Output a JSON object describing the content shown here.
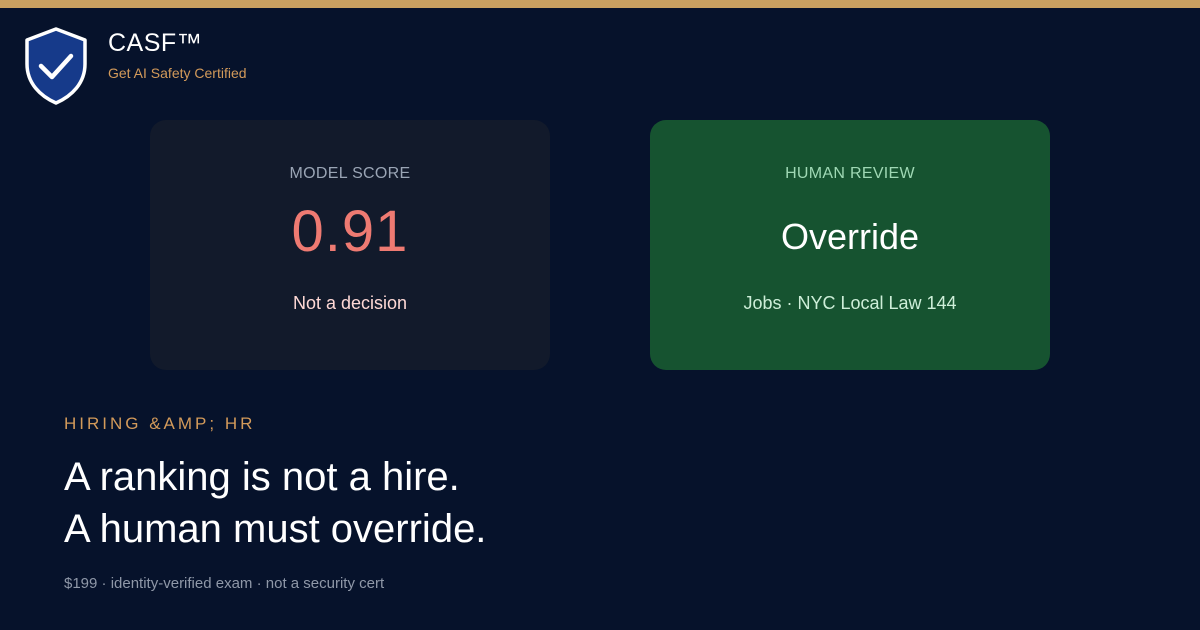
{
  "brand": {
    "name": "CASF™",
    "tagline": "Get AI Safety Certified",
    "icon": "shield-check-icon",
    "accent_color": "#c9a061"
  },
  "cards": {
    "model_score": {
      "label": "MODEL SCORE",
      "value": "0.91",
      "subtext": "Not a decision",
      "value_color": "#ee7a72"
    },
    "human_review": {
      "label": "HUMAN REVIEW",
      "value": "Override",
      "subtext": "Jobs · NYC Local Law 144",
      "background_color": "#165330"
    }
  },
  "content": {
    "eyebrow": "HIRING &AMP; HR",
    "headline_line1": "A ranking is not a hire.",
    "headline_line2": "A human must override.",
    "footnote": "$199 · identity-verified exam · not a security cert"
  },
  "colors": {
    "background": "#06122b",
    "shield_fill": "#163a8a",
    "tagline": "#d39a5a"
  }
}
